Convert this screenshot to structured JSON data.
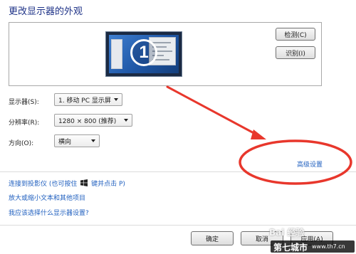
{
  "page": {
    "title": "更改显示器的外观"
  },
  "preview": {
    "display_number": "1",
    "detect_button": "检测(C)",
    "identify_button": "识别(I)"
  },
  "settings": {
    "display_label": "显示器(S):",
    "display_value": "1. 移动 PC 显示屏",
    "resolution_label": "分辨率(R):",
    "resolution_value": "1280 × 800 (推荐)",
    "orientation_label": "方向(O):",
    "orientation_value": "横向"
  },
  "links": {
    "advanced": "高级设置",
    "projector_prefix": "连接到投影仪 (也可按住",
    "projector_suffix": "键并点击 P)",
    "text_size": "放大或缩小文本和其他项目",
    "which_settings": "我应该选择什么显示器设置?"
  },
  "footer": {
    "ok": "确定",
    "cancel": "取消",
    "apply": "应用(A)"
  },
  "watermark": {
    "brand": "第七城市",
    "site": "www.th7.cn",
    "baidu": "Bai 经验"
  },
  "colors": {
    "title": "#1e3287",
    "link": "#1f5fbf",
    "annotation": "#e8372c"
  }
}
